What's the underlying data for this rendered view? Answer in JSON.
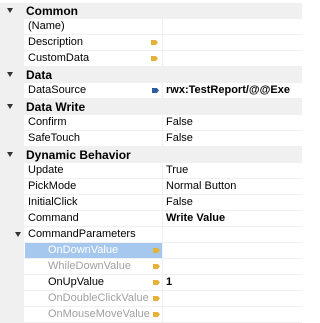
{
  "categories": {
    "common": "Common",
    "data": "Data",
    "data_write": "Data Write",
    "dynamic_behavior": "Dynamic Behavior"
  },
  "props": {
    "name": {
      "label": "(Name)",
      "value": ""
    },
    "description": {
      "label": "Description",
      "value": ""
    },
    "customdata": {
      "label": "CustomData",
      "value": ""
    },
    "datasource": {
      "label": "DataSource",
      "value": "rwx:TestReport/@@Exe"
    },
    "confirm": {
      "label": "Confirm",
      "value": "False"
    },
    "safetouch": {
      "label": "SafeTouch",
      "value": "False"
    },
    "update": {
      "label": "Update",
      "value": "True"
    },
    "pickmode": {
      "label": "PickMode",
      "value": "Normal Button"
    },
    "initialclick": {
      "label": "InitialClick",
      "value": "False"
    },
    "command": {
      "label": "Command",
      "value": "Write Value"
    },
    "commandparameters": {
      "label": "CommandParameters",
      "value": ""
    },
    "ondownvalue": {
      "label": "OnDownValue",
      "value": ""
    },
    "whiledownvalue": {
      "label": "WhileDownValue",
      "value": ""
    },
    "onupvalue": {
      "label": "OnUpValue",
      "value": "1"
    },
    "ondoubleclickvalue": {
      "label": "OnDoubleClickValue",
      "value": ""
    },
    "onmousemovevalue": {
      "label": "OnMouseMoveValue",
      "value": ""
    }
  },
  "colors": {
    "category_bg": "#f0f0f0",
    "selection_bg": "#a6c8ee",
    "marker_orange": "#e2b33b",
    "marker_blue": "#2d5d9f",
    "disabled_text": "#a0a0a0"
  },
  "icons": {
    "category_expander": "triangle-down",
    "value_marker": "binding-marker"
  }
}
